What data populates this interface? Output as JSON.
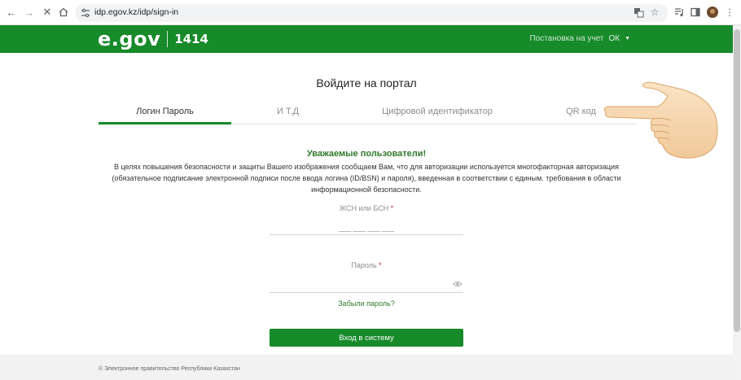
{
  "browser": {
    "url": "idp.egov.kz/idp/sign-in"
  },
  "header": {
    "logo": "e.gov",
    "phone": "1414",
    "register_link": "Постановка на учет",
    "language": "ОК"
  },
  "main": {
    "title": "Войдите на портал",
    "tabs": [
      {
        "label": "Логин Пароль"
      },
      {
        "label": "И Т.Д"
      },
      {
        "label": "Цифровой идентификатор"
      },
      {
        "label": "QR код"
      }
    ],
    "notice_title": "Уважаемые пользователи!",
    "notice_body": "В целях повышения безопасности и защиты Вашего изображения сообщаем Вам, что для авторизации используется многофакторная авторизация (обязательное подписание электронной подписи после ввода логина (ID/BSN) и пароля), введенная в соответствии с единым. требования в области информационной безопасности.",
    "iin_label": "ЖСН или БСН",
    "iin_placeholder": "___ ___ ___ ___",
    "password_label": "Пароль",
    "required_mark": "*",
    "forgot_password": "Забыли пароль?",
    "login_button": "Вход в систему"
  },
  "footer": {
    "text": "© Электронное правительство Республики Казахстан"
  },
  "colors": {
    "brand_green": "#178a2a",
    "notice_green": "#2f7a2a"
  }
}
